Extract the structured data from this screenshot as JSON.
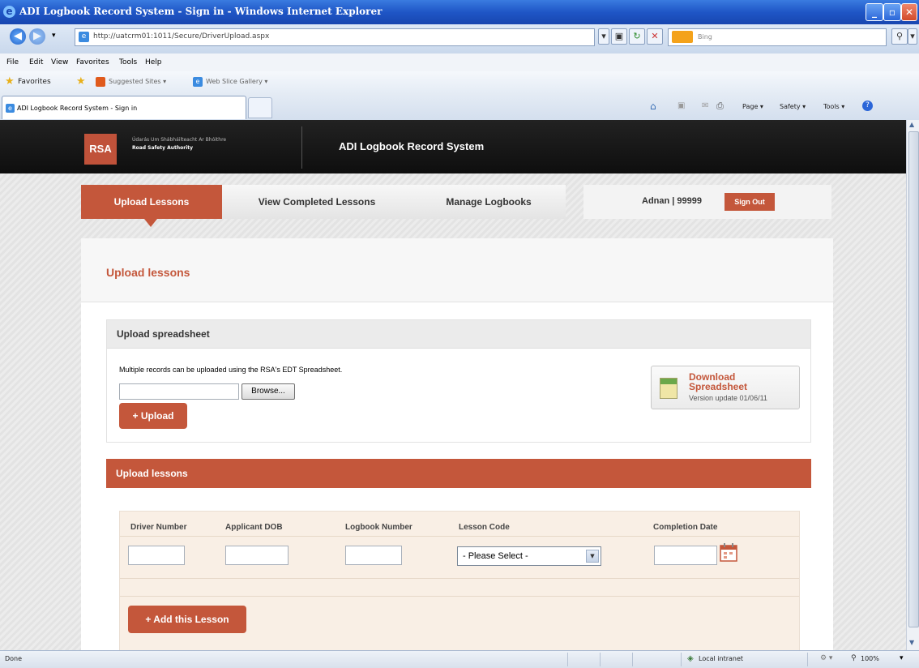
{
  "window": {
    "title": "ADI Logbook Record System - Sign in - Windows Internet Explorer",
    "controls": [
      "minimize",
      "maximize",
      "close"
    ]
  },
  "browser": {
    "url": "http://uatcrm01:1011/Secure/DriverUpload.aspx",
    "search_placeholder": "Bing",
    "menu": [
      "File",
      "Edit",
      "View",
      "Favorites",
      "Tools",
      "Help"
    ],
    "favorites_label": "Favorites",
    "favorites_items": [
      "Suggested Sites ▾",
      "Web Slice Gallery ▾"
    ],
    "tab_title": "ADI Logbook Record System - Sign in",
    "toolbar": [
      "Page ▾",
      "Safety ▾",
      "Tools ▾"
    ]
  },
  "site": {
    "logo_text": "RSA",
    "org_irish": "Údarás Um Shábháilteacht Ar Bhóithre",
    "org_name": "Road Safety Authority",
    "system_title": "ADI Logbook Record System",
    "nav": [
      "Upload Lessons",
      "View Completed Lessons",
      "Manage Logbooks"
    ],
    "active_nav": "Upload Lessons",
    "user_label": "Adnan | 99999",
    "sign_out": "Sign Out"
  },
  "content": {
    "title": "Upload lessons",
    "spreadsheet": {
      "title": "Upload spreadsheet",
      "description": "Multiple records can be uploaded using the RSA's EDT Spreadsheet.",
      "file_value": "",
      "browse_label": "Browse...",
      "upload_label": "+ Upload",
      "download_title": "Download Spreadsheet",
      "download_version": "Version update 01/06/11"
    },
    "lessons": {
      "title": "Upload lessons",
      "columns": [
        "Driver Number",
        "Applicant DOB",
        "Logbook Number",
        "Lesson Code",
        "Completion Date"
      ],
      "lesson_code_selected": "- Please Select -",
      "add_label": "+ Add this Lesson"
    }
  },
  "status": {
    "text": "Done",
    "zone": "Local intranet",
    "zoom": "100%"
  },
  "colors": {
    "accent": "#c4573b",
    "header": "#111111"
  }
}
